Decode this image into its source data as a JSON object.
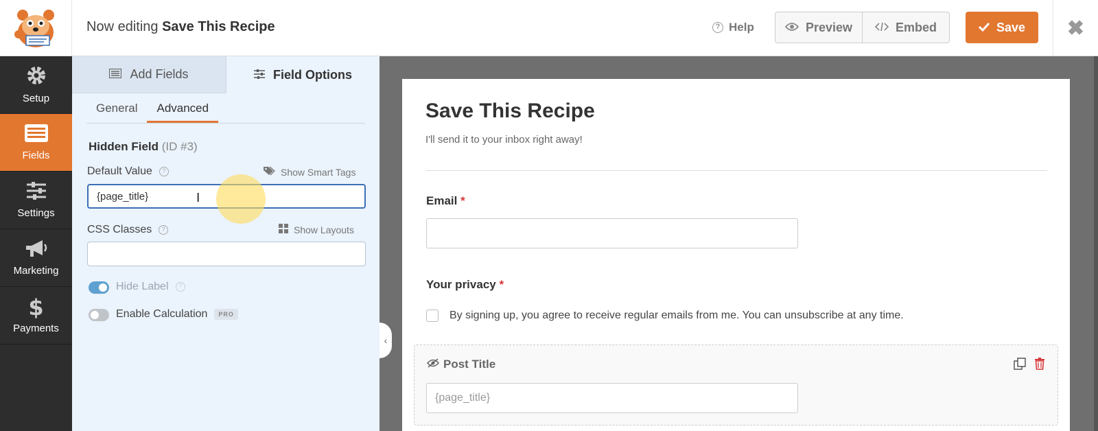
{
  "header": {
    "editing_prefix": "Now editing",
    "form_name": "Save This Recipe",
    "help_label": "Help",
    "preview_label": "Preview",
    "embed_label": "Embed",
    "save_label": "Save"
  },
  "nav": {
    "items": [
      {
        "label": "Setup",
        "icon": "gear-icon"
      },
      {
        "label": "Fields",
        "icon": "fields-list-icon",
        "active": true
      },
      {
        "label": "Settings",
        "icon": "sliders-icon"
      },
      {
        "label": "Marketing",
        "icon": "megaphone-icon"
      },
      {
        "label": "Payments",
        "icon": "dollar-icon"
      }
    ]
  },
  "panel": {
    "tabs": [
      {
        "label": "Add Fields",
        "icon": "list-icon"
      },
      {
        "label": "Field Options",
        "icon": "sliders-icon",
        "active": true
      }
    ],
    "subtabs": [
      {
        "label": "General"
      },
      {
        "label": "Advanced",
        "active": true
      }
    ],
    "field_heading": "Hidden Field",
    "field_id": "(ID #3)",
    "default_value_label": "Default Value",
    "smart_tags_link": "Show Smart Tags",
    "default_value": "{page_title}",
    "css_classes_label": "CSS Classes",
    "layouts_link": "Show Layouts",
    "css_classes_value": "",
    "hide_label": "Hide Label",
    "hide_label_on": true,
    "enable_calc_label": "Enable Calculation",
    "enable_calc_on": false,
    "pro_badge": "PRO"
  },
  "form": {
    "title": "Save This Recipe",
    "description": "I'll send it to your inbox right away!",
    "email_label": "Email",
    "required_mark": "*",
    "privacy_label": "Your privacy",
    "privacy_text": "By signing up, you agree to receive regular emails from me. You can unsubscribe at any time.",
    "hidden_field_label": "Post Title",
    "hidden_field_value": "{page_title}"
  },
  "colors": {
    "accent": "#e27730",
    "nav_bg": "#2d2d2d",
    "panel_bg": "#ebf3fc",
    "preview_bg": "#6f6f6f",
    "required": "#d63638"
  }
}
